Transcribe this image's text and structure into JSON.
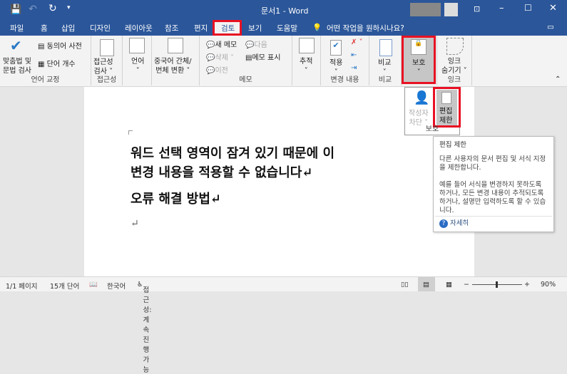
{
  "title": {
    "doc_title": "문서1 - Word"
  },
  "tabs": [
    "파일",
    "홈",
    "삽입",
    "디자인",
    "레이아웃",
    "참조",
    "편지",
    "검토",
    "보기",
    "도움말"
  ],
  "active_tab": "검토",
  "tell_me": "어떤 작업을 원하시나요?",
  "ribbon": {
    "proofing": {
      "spelling": "맞춤법 및",
      "spelling2": "문법 검사",
      "thesaurus": "동의어 사전",
      "wordcount": "단어 개수",
      "label": "언어 교정"
    },
    "accessibility": {
      "check": "접근성",
      "check2": "검사 ˅",
      "label": "접근성"
    },
    "language": {
      "btn": "언어",
      "arrow": "˅"
    },
    "chinese": {
      "btn": "중국어 간체/",
      "btn2": "번체 변환 ˅"
    },
    "comments": {
      "new": "새 메모",
      "delete": "삭제",
      "prev": "이전",
      "next": "다음",
      "show": "메모 표시",
      "label": "메모"
    },
    "tracking": {
      "btn": "추적",
      "arrow": "˅"
    },
    "changes": {
      "accept": "적용",
      "arrow": "˅",
      "label": "변경 내용"
    },
    "compare": {
      "btn": "비교",
      "arrow": "˅",
      "label": "비교"
    },
    "protect": {
      "btn": "보호",
      "arrow": "˅"
    },
    "ink": {
      "btn": "잉크",
      "btn2": "숨기기 ˅",
      "label": "잉크"
    }
  },
  "dropdown": {
    "block_authors": "작성자",
    "block_authors2": "차단 ˅",
    "restrict": "편집",
    "restrict2": "제한",
    "label": "보호"
  },
  "tooltip": {
    "title": "편집 제한",
    "p1": "다른 사용자의 문서 편집 및 서식 지정을 제한합니다.",
    "p2": "예를 들어 서식을 변경하지 못하도록 하거나, 모든 변경 내용이 추적되도록 하거나, 설명만 입력하도록 할 수 있습니다.",
    "more": "자세히"
  },
  "document": {
    "line1": "워드 선택 영역이 잠겨 있기 때문에 이",
    "line2": "변경 내용을 적용할 수 없습니다↵",
    "line3": "오류 해결 방법↵",
    "line4": "↵"
  },
  "status": {
    "page": "1/1 페이지",
    "words": "15개 단어",
    "lang": "한국어",
    "access": "접근성: 계속 진행 가능",
    "zoom": "90%"
  },
  "zoom_percent": 90
}
